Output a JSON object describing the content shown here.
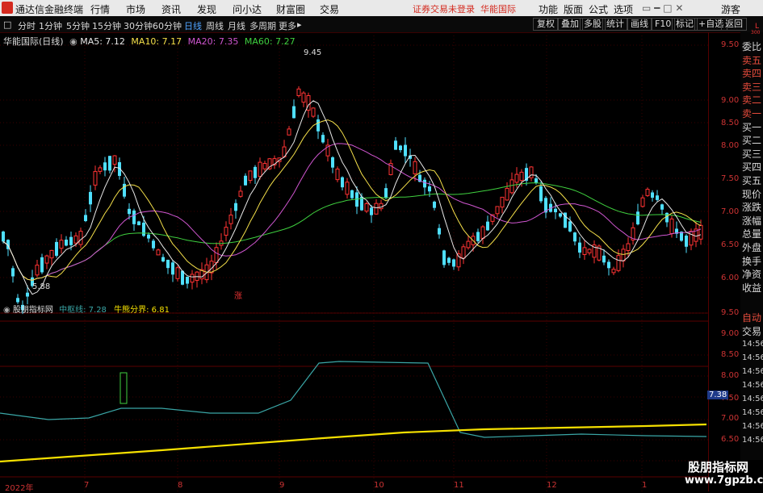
{
  "menu": {
    "app_name": "通达信金融终端",
    "items": [
      "行情",
      "市场",
      "资讯",
      "发现",
      "问小达",
      "财富圈",
      "交易"
    ],
    "notice_left": "证券交易未登录",
    "notice_right": "华能国际",
    "right_items": [
      "功能",
      "版面",
      "公式",
      "选项"
    ],
    "guest": "游客"
  },
  "toolbar": {
    "periods": [
      "分时",
      "1分钟",
      "5分钟",
      "15分钟",
      "30分钟",
      "60分钟",
      "日线",
      "周线",
      "月线",
      "多周期",
      "更多"
    ],
    "active_period": "日线",
    "right_buttons": [
      "复权",
      "叠加",
      "多股",
      "统计",
      "画线",
      "F10",
      "标记",
      "+自选",
      "返回"
    ]
  },
  "chart_header": {
    "name": "华能国际(日线)",
    "ma5": "MA5: 7.12",
    "ma10": "MA10: 7.17",
    "ma20": "MA20: 7.35",
    "ma60": "MA60: 7.27"
  },
  "indicator_header": {
    "name": "股朋指标网",
    "zhongshu": "中枢线: 7.28",
    "niuxiong": "牛熊分界: 6.81"
  },
  "annotations": {
    "high": "9.45",
    "low": "5.88",
    "zhang": "涨"
  },
  "price_axis": [
    "9.50",
    "9.00",
    "8.50",
    "8.00",
    "7.50",
    "7.00",
    "6.50",
    "6.00"
  ],
  "ind_axis": [
    "9.50",
    "9.00",
    "8.50",
    "8.00",
    "7.50",
    "7.00",
    "6.50"
  ],
  "ind_badge": "7.38",
  "sidebar_top": {
    "L": "L",
    "num": "300"
  },
  "sidebar": [
    "委比",
    "卖五",
    "卖四",
    "卖三",
    "卖二",
    "卖一",
    "买一",
    "买二",
    "买三",
    "买四",
    "买五",
    "现价",
    "涨跌",
    "涨幅",
    "总量",
    "外盘",
    "换手",
    "净资",
    "收益"
  ],
  "sidebar_lower": [
    "自动",
    "交易"
  ],
  "times": [
    "14:56",
    "14:56",
    "14:56",
    "14:56",
    "14:56",
    "14:56",
    "14:56",
    "14:56"
  ],
  "x_labels": [
    "2022年",
    "7",
    "8",
    "9",
    "10",
    "11",
    "12",
    "1"
  ],
  "watermark": {
    "line1": "股朋指标网",
    "line2": "www.7gpzb.com"
  },
  "colors": {
    "up": "#ff3333",
    "down": "#4fe0ff",
    "ma5": "#e8e8e8",
    "ma10": "#f5e04a",
    "ma20": "#d056d0",
    "ma60": "#3fd03f",
    "zhongshu": "#3aa6a6",
    "niuxiong": "#f5e000"
  }
}
